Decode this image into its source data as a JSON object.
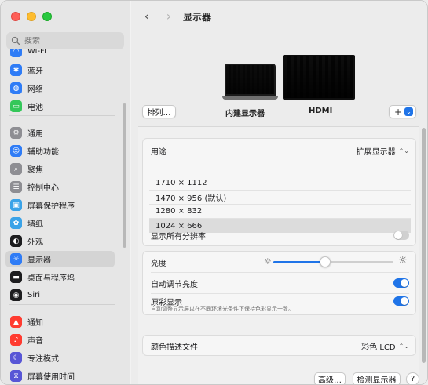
{
  "sidebar": {
    "search_placeholder": "搜索",
    "items": [
      {
        "label": "Wi-Fi",
        "icon": "wifi-icon",
        "color": "#2f7cf6"
      },
      {
        "label": "蓝牙",
        "icon": "bluetooth-icon",
        "color": "#2f7cf6"
      },
      {
        "label": "网络",
        "icon": "network-icon",
        "color": "#2f7cf6"
      },
      {
        "label": "电池",
        "icon": "battery-icon",
        "color": "#34c759"
      },
      {
        "label": "通用",
        "icon": "gear-icon",
        "color": "#8e8e93"
      },
      {
        "label": "辅助功能",
        "icon": "accessibility-icon",
        "color": "#2f7cf6"
      },
      {
        "label": "聚焦",
        "icon": "magnifier-icon",
        "color": "#8e8e93"
      },
      {
        "label": "控制中心",
        "icon": "control-center-icon",
        "color": "#8e8e93"
      },
      {
        "label": "屏幕保护程序",
        "icon": "screensaver-icon",
        "color": "#3aa3e8"
      },
      {
        "label": "墙纸",
        "icon": "wallpaper-icon",
        "color": "#3aa3e8"
      },
      {
        "label": "外观",
        "icon": "appearance-icon",
        "color": "#1d1d1f"
      },
      {
        "label": "显示器",
        "icon": "display-icon",
        "color": "#2f7cf6"
      },
      {
        "label": "桌面与程序坞",
        "icon": "dock-icon",
        "color": "#1d1d1f"
      },
      {
        "label": "Siri",
        "icon": "siri-icon",
        "color": "#1d1d1f"
      },
      {
        "label": "通知",
        "icon": "notification-icon",
        "color": "#ff3b30"
      },
      {
        "label": "声音",
        "icon": "sound-icon",
        "color": "#ff3b30"
      },
      {
        "label": "专注模式",
        "icon": "focus-icon",
        "color": "#5856d6"
      },
      {
        "label": "屏幕使用时间",
        "icon": "screen-time-icon",
        "color": "#5856d6"
      }
    ]
  },
  "header": {
    "title": "显示器",
    "back": "‹",
    "forward": "›"
  },
  "displays": {
    "arrange_label": "排列…",
    "builtin_label": "内建显示器",
    "hdmi_label": "HDMI",
    "add_label": "+",
    "add_chevron": "⌄"
  },
  "usage": {
    "label": "用途",
    "value": "扩展显示器",
    "arrows": "⌃⌄"
  },
  "resolutions": [
    {
      "label": "1710 × 1112"
    },
    {
      "label": "1470 × 956 (默认)"
    },
    {
      "label": "1280 × 832"
    },
    {
      "label": "1024 × 666"
    }
  ],
  "selected_resolution": "1024 × 666",
  "show_all": {
    "label": "显示所有分辨率",
    "on": false
  },
  "brightness": {
    "label": "亮度",
    "value": 0.43
  },
  "auto_brightness": {
    "label": "自动调节亮度",
    "on": true
  },
  "true_tone": {
    "label": "原彩显示",
    "description": "自动调整显示屏以在不同环境光条件下保持色彩显示一致。",
    "on": true
  },
  "color_profile": {
    "label": "颜色描述文件",
    "value": "彩色 LCD",
    "arrows": "⌃⌄"
  },
  "bottom": {
    "advanced_label": "高级…",
    "detect_label": "检测显示器",
    "help_label": "?"
  },
  "accent": "#1f74e8"
}
